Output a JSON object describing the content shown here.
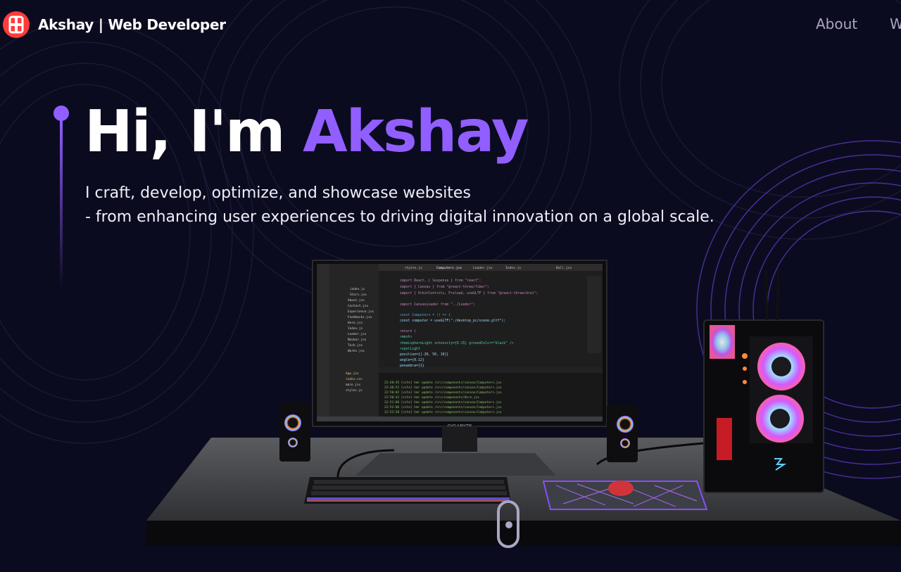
{
  "nav": {
    "brand": "Akshay | Web Developer",
    "links": [
      "About",
      "W"
    ]
  },
  "hero": {
    "greeting": "Hi, I'm",
    "name": "Akshay",
    "subtitle_line1": "I craft, develop, optimize, and showcase websites",
    "subtitle_line2": "- from enhancing user experiences to driving digital innovation on a global scale."
  },
  "scene": {
    "monitor_brand": "GIGABYTE",
    "editor_tabs": [
      "styles.js",
      "Computers.jsx",
      "Loader.jsx",
      "Index.js",
      "Ball.jsx"
    ],
    "code_lines": [
      "import React, { Suspense } from \"react\";",
      "import { Canvas } from \"@react-three/fiber\";",
      "import { OrbitControls, Preload, useGLTF } from \"@react-three/drei\";",
      "",
      "import CanvasLoader from \"../Loader\";",
      "",
      "const Computers = () => {",
      "  const computer = useGLTF(\"./desktop_pc/scene.gltf\");",
      "",
      "  return (",
      "    <mesh>",
      "      <hemisphereLight intensity={0.15} groundColor=\"black\" />",
      "      <spotLight",
      "        position={[-20, 50, 10]}",
      "        angle={0.12}",
      "        penumbra={1}"
    ],
    "files": [
      "index.js",
      "Stars.jsx",
      "About.jsx",
      "Contact.jsx",
      "Experience.jsx",
      "Feedbacks.jsx",
      "Hero.jsx",
      "Index.js",
      "Loader.jsx",
      "Navbar.jsx",
      "Tech.jsx",
      "Works.jsx",
      "App.jsx",
      "index.css",
      "main.jsx",
      "styles.js"
    ],
    "terminal_lines": [
      "22:48:45 [vite] hmr update /src/components/canvas/Computers.jsx",
      "22:48:51 [vite] hmr update /src/components/canvas/Computers.jsx",
      "22:50:02 [vite] hmr update /src/components/canvas/Computers.jsx",
      "22:50:42 [vite] hmr update /src/components/Hero.jsx",
      "22:51:06 [vite] hmr update /src/components/canvas/Computers.jsx",
      "22:52:06 [vite] hmr update /src/components/canvas/Computers.jsx",
      "22:52:58 [vite] hmr update /src/components/canvas/Computers.jsx"
    ]
  },
  "colors": {
    "background": "#0b0b1f",
    "accent": "#915eff",
    "nav_link": "#aaa6c3",
    "logo": "#ff3b3b"
  }
}
